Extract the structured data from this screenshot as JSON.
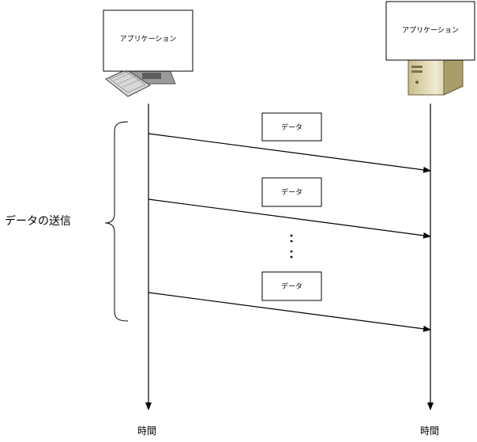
{
  "client": {
    "label": "アプリケーション"
  },
  "server": {
    "label": "アプリケーション"
  },
  "packets": [
    {
      "label": "データ"
    },
    {
      "label": "データ"
    },
    {
      "label": "データ"
    }
  ],
  "bracket_label": "データの送信",
  "ellipsis": "⋮",
  "timeline_left": {
    "label": "時間"
  },
  "timeline_right": {
    "label": "時間"
  }
}
